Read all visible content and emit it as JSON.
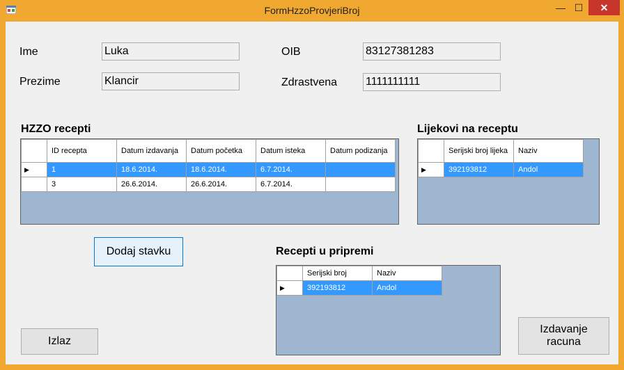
{
  "window": {
    "title": "FormHzzoProvjeriBroj",
    "min_glyph": "—",
    "max_glyph": "☐",
    "close_glyph": "✕"
  },
  "patient": {
    "ime_label": "Ime",
    "ime_value": "Luka",
    "prezime_label": "Prezime",
    "prezime_value": "Klancir",
    "oib_label": "OIB",
    "oib_value": "83127381283",
    "zdravstvena_label": "Zdrastvena",
    "zdravstvena_value": "1111111111"
  },
  "hzzo": {
    "heading": "HZZO recepti",
    "columns": [
      "ID recepta",
      "Datum izdavanja",
      "Datum početka",
      "Datum isteka",
      "Datum podizanja"
    ],
    "rows": [
      [
        "1",
        "18.6.2014.",
        "18.6.2014.",
        "6.7.2014.",
        ""
      ],
      [
        "3",
        "26.6.2014.",
        "26.6.2014.",
        "6.7.2014.",
        ""
      ]
    ]
  },
  "lijekovi": {
    "heading": "Lijekovi na receptu",
    "columns": [
      "Serijski broj lijeka",
      "Naziv"
    ],
    "rows": [
      [
        "392193812",
        "Andol"
      ]
    ]
  },
  "priprema": {
    "heading": "Recepti u pripremi",
    "columns": [
      "Serijski broj",
      "Naziv"
    ],
    "rows": [
      [
        "392193812",
        "Andol"
      ]
    ]
  },
  "buttons": {
    "dodaj": "Dodaj stavku",
    "izlaz": "Izlaz",
    "izdavanje": "Izdavanje racuna"
  },
  "row_marker": "▶"
}
